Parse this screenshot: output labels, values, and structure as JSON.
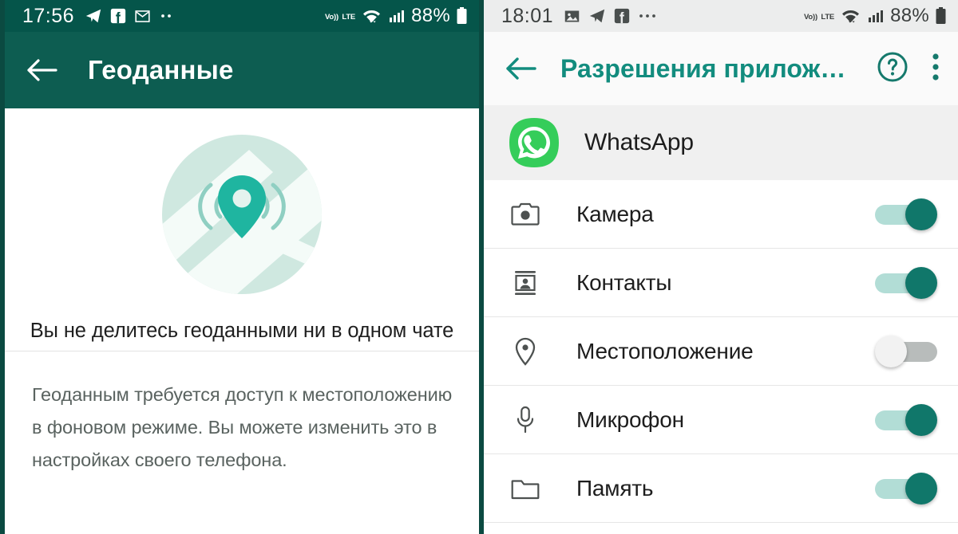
{
  "left_screen": {
    "statusbar": {
      "time": "17:56",
      "notification_icons": [
        "telegram-icon",
        "facebook-icon",
        "gmail-icon",
        "more-dots-icon"
      ],
      "network_label": "Vo))",
      "network_type": "LTE",
      "battery_percent": "88%",
      "status_icons": [
        "volte-icon",
        "wifi-icon",
        "signal-icon",
        "battery-icon"
      ]
    },
    "appbar": {
      "back_icon": "arrow-left-icon",
      "title": "Геоданные",
      "background_color": "#0d5d51"
    },
    "illustration": {
      "name": "location-map-illustration",
      "circle_color": "#cfe8e0",
      "road_color": "#f2faf7",
      "pin_color": "#1fb5a0"
    },
    "empty_state_text": "Вы не делитесь геоданными ни в одном чате",
    "note_text": "Геоданным требуется доступ к местоположению в фоновом режиме. Вы можете изменить это в настройках своего телефона."
  },
  "right_screen": {
    "statusbar": {
      "time": "18:01",
      "notification_icons": [
        "gallery-icon",
        "telegram-icon",
        "facebook-icon",
        "more-dots-icon"
      ],
      "network_label": "Vo))",
      "network_type": "LTE",
      "battery_percent": "88%",
      "status_icons": [
        "volte-icon",
        "wifi-icon",
        "signal-icon",
        "battery-icon"
      ],
      "background_color": "#eceded"
    },
    "appbar": {
      "back_icon": "arrow-left-icon",
      "title": "Разрешения прилож…",
      "title_color": "#128c7e",
      "help_icon": "help-circle-icon",
      "overflow_icon": "overflow-menu-icon"
    },
    "app": {
      "icon": "whatsapp-icon",
      "name": "WhatsApp",
      "icon_color": "#35cd5a"
    },
    "permissions": [
      {
        "icon": "camera-icon",
        "label": "Камера",
        "enabled": true
      },
      {
        "icon": "contacts-icon",
        "label": "Контакты",
        "enabled": true
      },
      {
        "icon": "location-icon",
        "label": "Местоположение",
        "enabled": false
      },
      {
        "icon": "microphone-icon",
        "label": "Микрофон",
        "enabled": true
      },
      {
        "icon": "folder-icon",
        "label": "Память",
        "enabled": true
      }
    ],
    "toggle_on_color": "#10776a",
    "toggle_off_color": "#b8bcbb"
  }
}
